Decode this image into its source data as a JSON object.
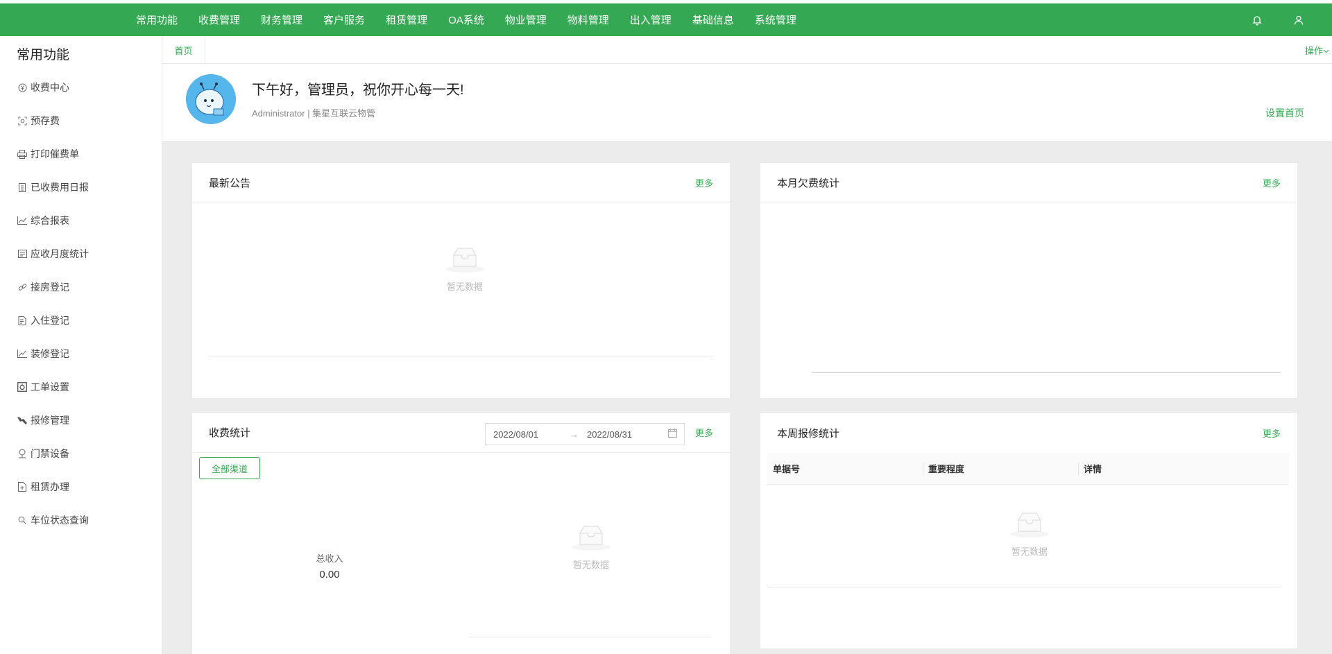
{
  "topnav": {
    "items": [
      "常用功能",
      "收费管理",
      "财务管理",
      "客户服务",
      "租赁管理",
      "OA系统",
      "物业管理",
      "物料管理",
      "出入管理",
      "基础信息",
      "系统管理"
    ],
    "bell_icon": "bell-icon",
    "user_icon": "user-icon"
  },
  "sidebar": {
    "title": "常用功能",
    "items": [
      {
        "label": "收费中心",
        "icon": "yen-circle-icon"
      },
      {
        "label": "预存费",
        "icon": "deposit-icon"
      },
      {
        "label": "打印催费单",
        "icon": "printer-icon"
      },
      {
        "label": "已收费用日报",
        "icon": "report-icon"
      },
      {
        "label": "综合报表",
        "icon": "line-chart-icon"
      },
      {
        "label": "应收月度统计",
        "icon": "table-icon"
      },
      {
        "label": "接房登记",
        "icon": "link-icon"
      },
      {
        "label": "入住登记",
        "icon": "document-icon"
      },
      {
        "label": "装修登记",
        "icon": "chart-icon"
      },
      {
        "label": "工单设置",
        "icon": "settings-box-icon"
      },
      {
        "label": "报修管理",
        "icon": "tool-icon"
      },
      {
        "label": "门禁设备",
        "icon": "location-icon"
      },
      {
        "label": "租赁办理",
        "icon": "file-add-icon"
      },
      {
        "label": "车位状态查询",
        "icon": "search-icon"
      }
    ]
  },
  "tabs": {
    "home": "首页",
    "ops": "操作"
  },
  "welcome": {
    "greeting": "下午好，管理员，祝你开心每一天!",
    "subinfo": "Administrator | 集星互联云物管",
    "set_home": "设置首页"
  },
  "cards": {
    "notices": {
      "title": "最新公告",
      "more": "更多",
      "empty": "暂无数据"
    },
    "arrears": {
      "title": "本月欠费统计",
      "more": "更多"
    },
    "fees": {
      "title": "收费统计",
      "more": "更多",
      "date_start": "2022/08/01",
      "date_end": "2022/08/31",
      "channel_button": "全部渠道",
      "total_label": "总收入",
      "total_value": "0.00",
      "empty": "暂无数据"
    },
    "repairs": {
      "title": "本周报修统计",
      "more": "更多",
      "columns": [
        "单据号",
        "重要程度",
        "详情"
      ],
      "empty": "暂无数据"
    }
  },
  "colors": {
    "brand": "#34a853",
    "background": "#ececec"
  }
}
